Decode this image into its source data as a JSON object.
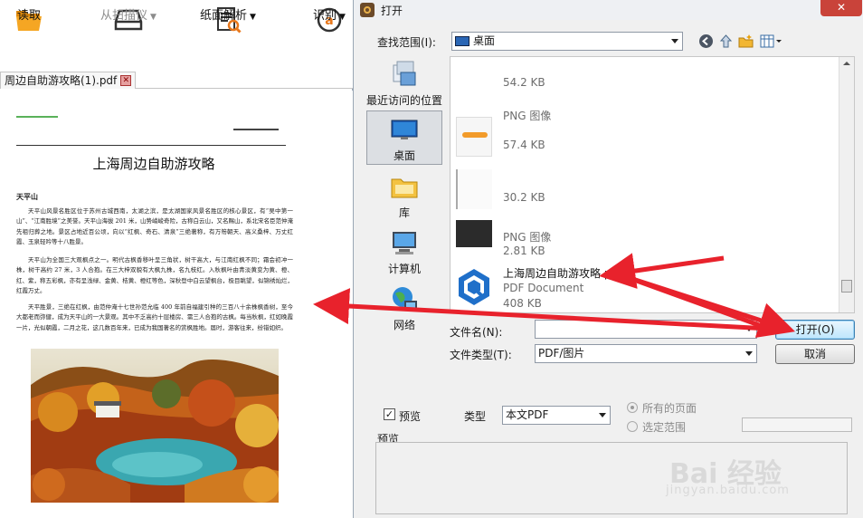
{
  "toolbar": {
    "read_label": "读取",
    "scanner_label": "从扫描仪",
    "paper_parse_label": "纸面解析",
    "recognize_label": "识别"
  },
  "doc_tab": {
    "filename": "周边自助游攻略(1).pdf"
  },
  "document": {
    "title": "上海周边自助游攻略",
    "section": "天平山",
    "para1": "天平山风景名胜区位于苏州古城西南，太湖之滨，是太湖国家风景名胜区的核心景区，有“吴中第一山”、“江南胜境”之美誉。天平山海拔 201 米，山势峭峻奇险，古称白云山，又名赐山，系北宋名臣范仲淹先祖归葬之地。景区占地近百公顷，向以“红枫、奇石、清泉”三绝著称，有万笏朝天、高义桑梓、万丈红霞、玉泉轻吟等十八胜景。",
    "para2": "天平山为全国三大观枫点之一。明代古枫香移叶呈三角状，树干高大，与江南红枫不同；霜会初冲一株，树干高约 27 米，3 人合抱。在三大梓双貌有大枫九株，名九枝红。入秋枫叶由青淡黄变为黄、橙、红、紫，称五彩枫，亦有呈浅绿、金黄、桔黄、橙红等色，深秋登中白云望枫台，极目眺望，似锦绣灿烂，红霞万丈。",
    "para3": "天平胜景，三绝在红枫，由范仲淹十七世孙范允临 400 年前自福建引种的三百八十余株枫香树，至今大都老而弥健，成为天平山的一大景观。其中不乏高约十层楼房、需三人合抱的古枫。每当秋枫，红如晚霞一片，光似朝霞，二月之花，这几数百年来，已成为我国著名的赏枫胜地。届时，游客往来，纷错如织。"
  },
  "dialog": {
    "title": "打开",
    "close_label": "✕",
    "lookin_label": "查找范围(I):",
    "lookin_value": "桌面",
    "places": [
      {
        "label": "最近访问的位置"
      },
      {
        "label": "桌面"
      },
      {
        "label": "库"
      },
      {
        "label": "计算机"
      },
      {
        "label": "网络"
      }
    ],
    "files": [
      {
        "name": "",
        "type": "",
        "size": "54.2 KB"
      },
      {
        "name": "",
        "type": "PNG 图像",
        "size": "57.4 KB"
      },
      {
        "name": "",
        "type": "",
        "size": "30.2 KB"
      },
      {
        "name": "",
        "type": "PNG 图像",
        "size": "2.81 KB"
      },
      {
        "name": "上海周边自助游攻略.pdf",
        "type": "PDF Document",
        "size": "408 KB"
      }
    ],
    "filename_label": "文件名(N):",
    "filename_value": "",
    "filetype_label": "文件类型(T):",
    "filetype_value": "PDF/图片",
    "open_label": "打开(O)",
    "cancel_label": "取消",
    "preview_check_label": "预览",
    "type_label": "类型",
    "type_value": "本文PDF",
    "all_pages_label": "所有的页面",
    "selection_label": "选定范围",
    "preview_label": "预览"
  },
  "watermark": {
    "brand": "Bai 经验",
    "url": "jingyan.baidu.com"
  },
  "colors": {
    "annotation_red": "#e8222c",
    "folder_orange": "#f2a11c",
    "pdf_blue": "#1f6fc9"
  }
}
